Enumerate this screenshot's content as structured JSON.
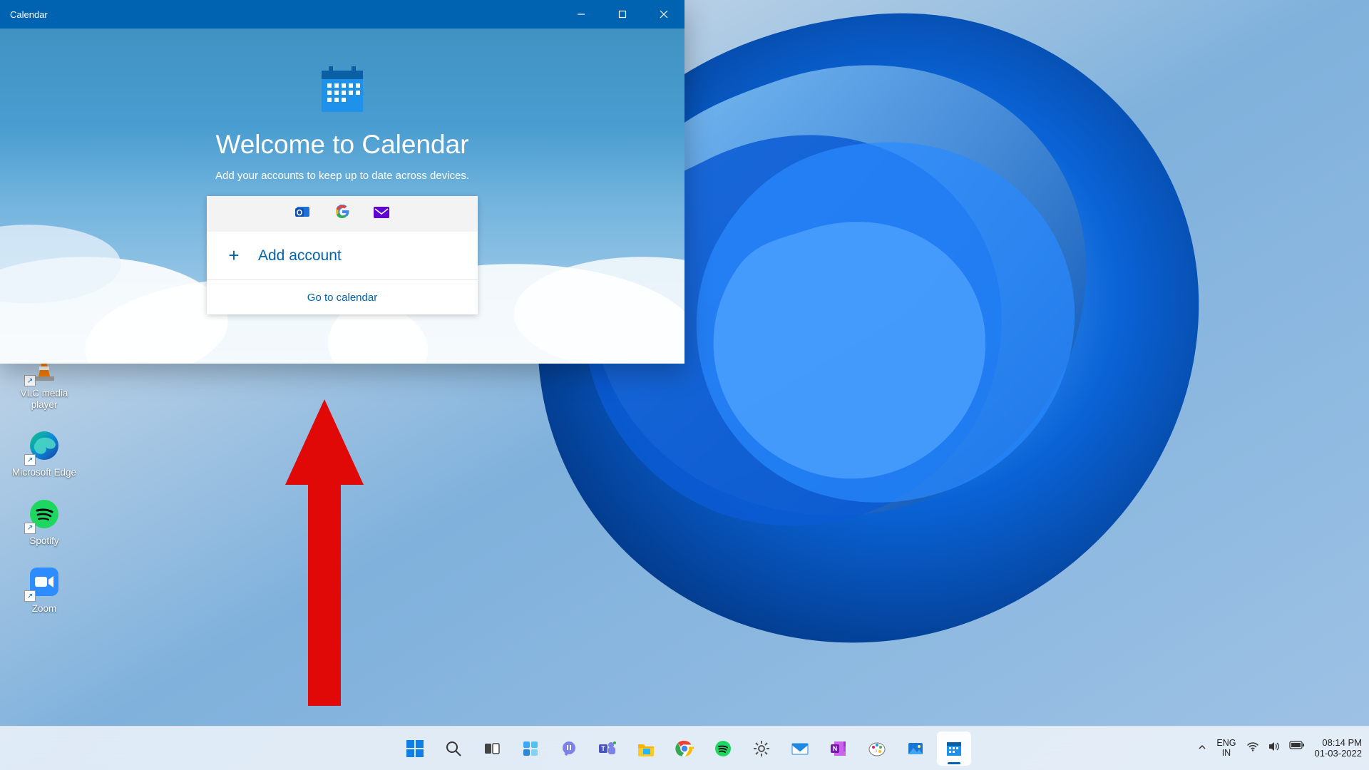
{
  "window": {
    "title": "Calendar",
    "heading": "Welcome to Calendar",
    "subheading": "Add your accounts to keep up to date across devices.",
    "add_account_label": "Add account",
    "go_to_calendar_label": "Go to calendar"
  },
  "desktop_icons": [
    {
      "name": "vlc",
      "label": "VLC media player"
    },
    {
      "name": "edge",
      "label": "Microsoft Edge"
    },
    {
      "name": "spotify",
      "label": "Spotify"
    },
    {
      "name": "zoom",
      "label": "Zoom"
    }
  ],
  "taskbar_center": [
    {
      "name": "start",
      "icon": "start-icon"
    },
    {
      "name": "search",
      "icon": "search-icon"
    },
    {
      "name": "taskview",
      "icon": "taskview-icon"
    },
    {
      "name": "widgets",
      "icon": "widgets-icon"
    },
    {
      "name": "chat",
      "icon": "chat-icon"
    },
    {
      "name": "teams",
      "icon": "teams-icon"
    },
    {
      "name": "explorer",
      "icon": "folder-icon"
    },
    {
      "name": "chrome",
      "icon": "chrome-icon"
    },
    {
      "name": "spotify",
      "icon": "spotify-icon"
    },
    {
      "name": "settings",
      "icon": "gear-icon"
    },
    {
      "name": "mail",
      "icon": "mail-icon"
    },
    {
      "name": "onenote",
      "icon": "onenote-icon"
    },
    {
      "name": "paint",
      "icon": "paint-icon"
    },
    {
      "name": "photos",
      "icon": "photos-icon"
    },
    {
      "name": "calendar",
      "icon": "calendar-icon",
      "active": true
    }
  ],
  "system_tray": {
    "lang_top": "ENG",
    "lang_bottom": "IN",
    "time": "08:14 PM",
    "date": "01-03-2022"
  },
  "colors": {
    "accent": "#0063b1",
    "annotation_red": "#e10808"
  }
}
